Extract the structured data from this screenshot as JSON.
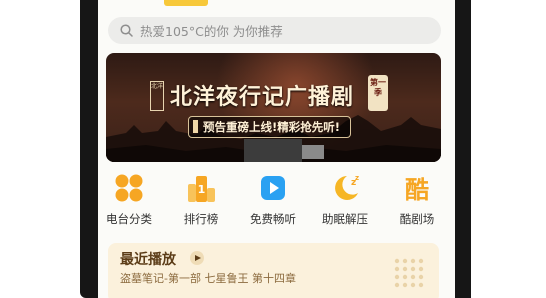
{
  "search": {
    "placeholder": "热爱105°C的你  为你推荐"
  },
  "banner": {
    "seal": "北洋",
    "title": "北洋夜行记广播剧",
    "season_badge": "第一季",
    "subtitle": "预告重磅上线!精彩抢先听!"
  },
  "categories": [
    {
      "label": "电台分类",
      "icon": "grid-icon"
    },
    {
      "label": "排行榜",
      "icon": "ranking-icon"
    },
    {
      "label": "免费畅听",
      "icon": "play-icon"
    },
    {
      "label": "助眠解压",
      "icon": "moon-sleep-icon"
    },
    {
      "label": "酷剧场",
      "icon": "theater-icon"
    }
  ],
  "recent": {
    "title": "最近播放",
    "subtitle": "盗墓笔记-第一部 七星鲁王 第十四章"
  },
  "colors": {
    "accent": "#f7c83a",
    "orange": "#f6a623",
    "blue": "#2aa1f2",
    "recent_bg": "#fbf1dc"
  }
}
